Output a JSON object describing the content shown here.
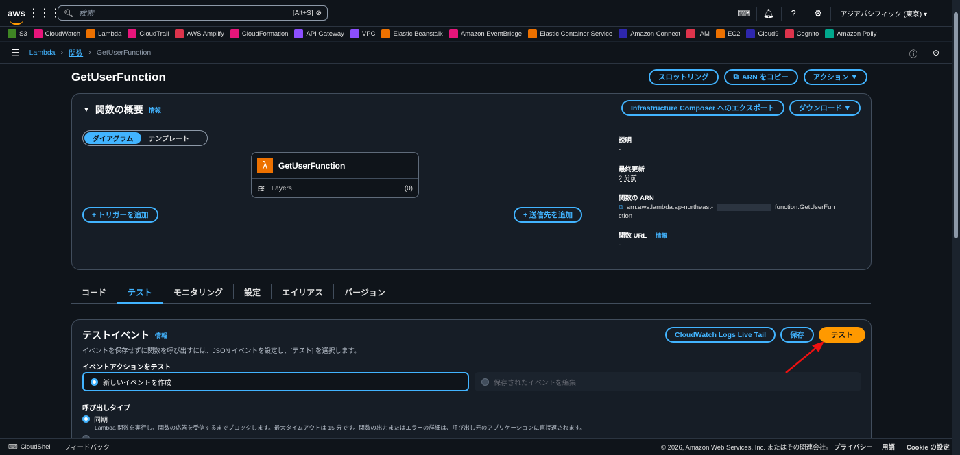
{
  "topbar": {
    "logo": "aws",
    "search_placeholder": "検索",
    "search_shortcut": "[Alt+S]",
    "region": "アジアパシフィック (東京) ▾"
  },
  "favorites": [
    {
      "label": "S3",
      "color": "#3f8624"
    },
    {
      "label": "CloudWatch",
      "color": "#e7157b"
    },
    {
      "label": "Lambda",
      "color": "#ed7100"
    },
    {
      "label": "CloudTrail",
      "color": "#e7157b"
    },
    {
      "label": "AWS Amplify",
      "color": "#dd344c"
    },
    {
      "label": "CloudFormation",
      "color": "#e7157b"
    },
    {
      "label": "API Gateway",
      "color": "#8c4fff"
    },
    {
      "label": "VPC",
      "color": "#8c4fff"
    },
    {
      "label": "Elastic Beanstalk",
      "color": "#ed7100"
    },
    {
      "label": "Amazon EventBridge",
      "color": "#e7157b"
    },
    {
      "label": "Elastic Container Service",
      "color": "#ed7100"
    },
    {
      "label": "Amazon Connect",
      "color": "#2e27ad"
    },
    {
      "label": "IAM",
      "color": "#dd344c"
    },
    {
      "label": "EC2",
      "color": "#ed7100"
    },
    {
      "label": "Cloud9",
      "color": "#2e27ad"
    },
    {
      "label": "Cognito",
      "color": "#dd344c"
    },
    {
      "label": "Amazon Polly",
      "color": "#01a88d"
    }
  ],
  "breadcrumb": {
    "root": "Lambda",
    "functions": "関数",
    "current": "GetUserFunction"
  },
  "header": {
    "title": "GetUserFunction",
    "throttle": "スロットリング",
    "copy_arn": "ARN をコピー",
    "actions": "アクション ▼"
  },
  "overview": {
    "title": "関数の概要",
    "info": "情報",
    "export": "Infrastructure Composer へのエクスポート",
    "download": "ダウンロード ▼",
    "toggle_diagram": "ダイアグラム",
    "toggle_template": "テンプレート",
    "fn_name": "GetUserFunction",
    "layers": "Layers",
    "layers_count": "(0)",
    "add_trigger": "+ トリガーを追加",
    "add_destination": "+ 送信先を追加",
    "desc_label": "説明",
    "desc_value": "-",
    "updated_label": "最終更新",
    "updated_value": "2 分前",
    "arn_label": "関数の ARN",
    "arn_part1": "arn:aws:lambda:ap-northeast-",
    "arn_part2": "function:GetUserFun",
    "arn_part3": "ction",
    "url_label": "関数 URL",
    "url_info": "情報",
    "url_value": "-"
  },
  "tabs": [
    "コード",
    "テスト",
    "モニタリング",
    "設定",
    "エイリアス",
    "バージョン"
  ],
  "test": {
    "title": "テストイベント",
    "info": "情報",
    "live_tail": "CloudWatch Logs Live Tail",
    "save": "保存",
    "test": "テスト",
    "desc": "イベントを保存せずに関数を呼び出すには、JSON イベントを設定し、[テスト] を選択します。",
    "action_label": "イベントアクションをテスト",
    "new_event": "新しいイベントを作成",
    "edit_saved": "保存されたイベントを編集",
    "invoke_label": "呼び出しタイプ",
    "sync": "同期",
    "sync_desc": "Lambda 関数を実行し、関数の応答を受信するまでブロックします。最大タイムアウトは 15 分です。関数の出力またはエラーの詳細は、呼び出し元のアプリケーションに直接返されます。"
  },
  "footer": {
    "cloudshell": "CloudShell",
    "feedback": "フィードバック",
    "copyright": "© 2026, Amazon Web Services, Inc. またはその関連会社。",
    "privacy": "プライバシー",
    "terms": "用語",
    "cookie": "Cookie の設定"
  }
}
